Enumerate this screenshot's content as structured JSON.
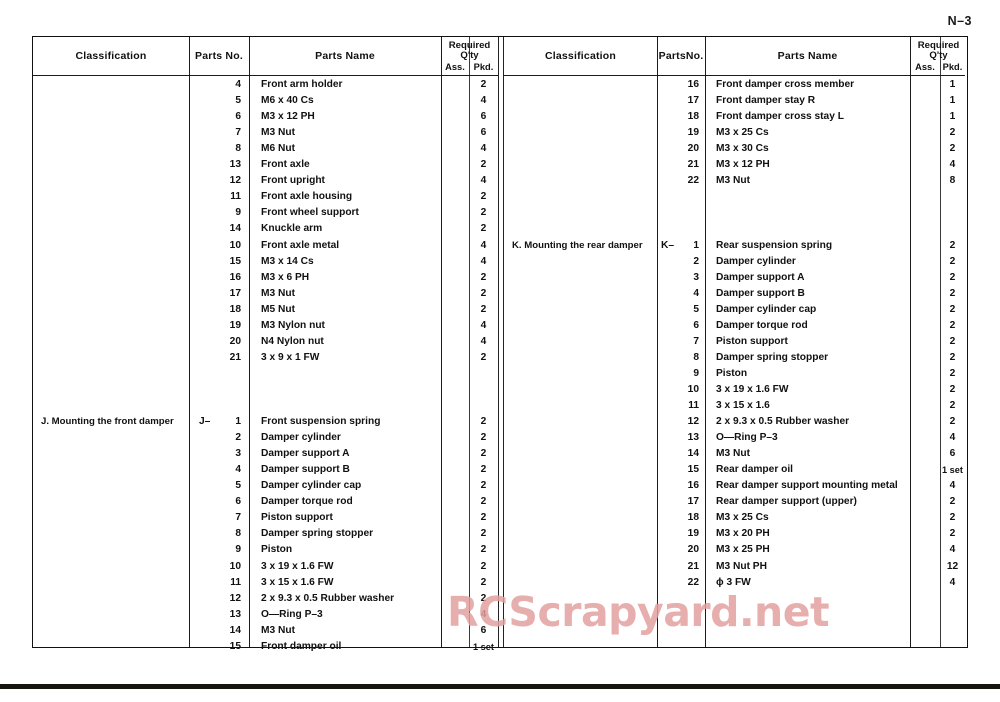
{
  "document": {
    "page_number": "N–3",
    "watermark": "RCScrapyard.net",
    "watermark_color": "#e3a0a0"
  },
  "header": {
    "classification": "Classification",
    "parts_no_left": "Parts No.",
    "parts_no_right": "PartsNo.",
    "parts_name": "Parts Name",
    "required": "Required",
    "qty": "Q'ty",
    "ass": "Ass.",
    "pkd": "Pkd."
  },
  "left_table": {
    "rows": [
      {
        "classification": "",
        "prefix": "",
        "no": "4",
        "name": "Front arm holder",
        "ass": "",
        "pkd": "2"
      },
      {
        "classification": "",
        "prefix": "",
        "no": "5",
        "name": "M6 x 40 Cs",
        "ass": "",
        "pkd": "4"
      },
      {
        "classification": "",
        "prefix": "",
        "no": "6",
        "name": "M3 x 12 PH",
        "ass": "",
        "pkd": "6"
      },
      {
        "classification": "",
        "prefix": "",
        "no": "7",
        "name": "M3 Nut",
        "ass": "",
        "pkd": "6"
      },
      {
        "classification": "",
        "prefix": "",
        "no": "8",
        "name": "M6 Nut",
        "ass": "",
        "pkd": "4"
      },
      {
        "classification": "",
        "prefix": "",
        "no": "13",
        "name": "Front axle",
        "ass": "",
        "pkd": "2"
      },
      {
        "classification": "",
        "prefix": "",
        "no": "12",
        "name": "Front upright",
        "ass": "",
        "pkd": "4"
      },
      {
        "classification": "",
        "prefix": "",
        "no": "11",
        "name": "Front axle housing",
        "ass": "",
        "pkd": "2"
      },
      {
        "classification": "",
        "prefix": "",
        "no": "9",
        "name": "Front wheel support",
        "ass": "",
        "pkd": "2"
      },
      {
        "classification": "",
        "prefix": "",
        "no": "14",
        "name": "Knuckle arm",
        "ass": "",
        "pkd": "2"
      },
      {
        "classification": "",
        "prefix": "",
        "no": "10",
        "name": "Front axle metal",
        "ass": "",
        "pkd": "4"
      },
      {
        "classification": "",
        "prefix": "",
        "no": "15",
        "name": "M3 x 14 Cs",
        "ass": "",
        "pkd": "4"
      },
      {
        "classification": "",
        "prefix": "",
        "no": "16",
        "name": "M3 x 6 PH",
        "ass": "",
        "pkd": "2"
      },
      {
        "classification": "",
        "prefix": "",
        "no": "17",
        "name": "M3 Nut",
        "ass": "",
        "pkd": "2"
      },
      {
        "classification": "",
        "prefix": "",
        "no": "18",
        "name": "M5 Nut",
        "ass": "",
        "pkd": "2"
      },
      {
        "classification": "",
        "prefix": "",
        "no": "19",
        "name": "M3 Nylon nut",
        "ass": "",
        "pkd": "4"
      },
      {
        "classification": "",
        "prefix": "",
        "no": "20",
        "name": "N4 Nylon nut",
        "ass": "",
        "pkd": "4"
      },
      {
        "classification": "",
        "prefix": "",
        "no": "21",
        "name": "3 x 9 x 1 FW",
        "ass": "",
        "pkd": "2"
      },
      {
        "classification": "",
        "prefix": "",
        "no": "",
        "name": "",
        "ass": "",
        "pkd": ""
      },
      {
        "classification": "",
        "prefix": "",
        "no": "",
        "name": "",
        "ass": "",
        "pkd": ""
      },
      {
        "classification": "",
        "prefix": "",
        "no": "",
        "name": "",
        "ass": "",
        "pkd": ""
      },
      {
        "classification": "J. Mounting the front damper",
        "prefix": "J–",
        "no": "1",
        "name": "Front suspension spring",
        "ass": "",
        "pkd": "2"
      },
      {
        "classification": "",
        "prefix": "",
        "no": "2",
        "name": "Damper cylinder",
        "ass": "",
        "pkd": "2"
      },
      {
        "classification": "",
        "prefix": "",
        "no": "3",
        "name": "Damper support A",
        "ass": "",
        "pkd": "2"
      },
      {
        "classification": "",
        "prefix": "",
        "no": "4",
        "name": "Damper support  B",
        "ass": "",
        "pkd": "2"
      },
      {
        "classification": "",
        "prefix": "",
        "no": "5",
        "name": "Damper cylinder cap",
        "ass": "",
        "pkd": "2"
      },
      {
        "classification": "",
        "prefix": "",
        "no": "6",
        "name": "Damper torque rod",
        "ass": "",
        "pkd": "2"
      },
      {
        "classification": "",
        "prefix": "",
        "no": "7",
        "name": "Piston support",
        "ass": "",
        "pkd": "2"
      },
      {
        "classification": "",
        "prefix": "",
        "no": "8",
        "name": "Damper spring stopper",
        "ass": "",
        "pkd": "2"
      },
      {
        "classification": "",
        "prefix": "",
        "no": "9",
        "name": "Piston",
        "ass": "",
        "pkd": "2"
      },
      {
        "classification": "",
        "prefix": "",
        "no": "10",
        "name": "3 x 19 x 1.6 FW",
        "ass": "",
        "pkd": "2"
      },
      {
        "classification": "",
        "prefix": "",
        "no": "11",
        "name": "3 x 15 x 1.6 FW",
        "ass": "",
        "pkd": "2"
      },
      {
        "classification": "",
        "prefix": "",
        "no": "12",
        "name": "2 x 9.3 x 0.5 Rubber washer",
        "ass": "",
        "pkd": "2"
      },
      {
        "classification": "",
        "prefix": "",
        "no": "13",
        "name": "O—Ring P–3",
        "ass": "",
        "pkd": "4"
      },
      {
        "classification": "",
        "prefix": "",
        "no": "14",
        "name": "M3 Nut",
        "ass": "",
        "pkd": "6"
      },
      {
        "classification": "",
        "prefix": "",
        "no": "15",
        "name": "Front damper oil",
        "ass": "",
        "pkd": "1 set"
      }
    ]
  },
  "right_table": {
    "rows": [
      {
        "classification": "",
        "prefix": "",
        "no": "16",
        "name": "Front damper cross member",
        "ass": "",
        "pkd": "1"
      },
      {
        "classification": "",
        "prefix": "",
        "no": "17",
        "name": "Front damper  stay R",
        "ass": "",
        "pkd": "1"
      },
      {
        "classification": "",
        "prefix": "",
        "no": "18",
        "name": "Front damper cross stay  L",
        "ass": "",
        "pkd": "1"
      },
      {
        "classification": "",
        "prefix": "",
        "no": "19",
        "name": "M3 x 25 Cs",
        "ass": "",
        "pkd": "2"
      },
      {
        "classification": "",
        "prefix": "",
        "no": "20",
        "name": "M3 x 30 Cs",
        "ass": "",
        "pkd": "2"
      },
      {
        "classification": "",
        "prefix": "",
        "no": "21",
        "name": "M3 x 12 PH",
        "ass": "",
        "pkd": "4"
      },
      {
        "classification": "",
        "prefix": "",
        "no": "22",
        "name": "M3 Nut",
        "ass": "",
        "pkd": "8"
      },
      {
        "classification": "",
        "prefix": "",
        "no": "",
        "name": "",
        "ass": "",
        "pkd": ""
      },
      {
        "classification": "",
        "prefix": "",
        "no": "",
        "name": "",
        "ass": "",
        "pkd": ""
      },
      {
        "classification": "",
        "prefix": "",
        "no": "",
        "name": "",
        "ass": "",
        "pkd": ""
      },
      {
        "classification": "K.  Mounting the rear damper",
        "prefix": "K–",
        "no": "1",
        "name": "Rear suspension spring",
        "ass": "",
        "pkd": "2"
      },
      {
        "classification": "",
        "prefix": "",
        "no": "2",
        "name": "Damper cylinder",
        "ass": "",
        "pkd": "2"
      },
      {
        "classification": "",
        "prefix": "",
        "no": "3",
        "name": "Damper support A",
        "ass": "",
        "pkd": "2"
      },
      {
        "classification": "",
        "prefix": "",
        "no": "4",
        "name": "Damper support B",
        "ass": "",
        "pkd": "2"
      },
      {
        "classification": "",
        "prefix": "",
        "no": "5",
        "name": "Damper cylinder cap",
        "ass": "",
        "pkd": "2"
      },
      {
        "classification": "",
        "prefix": "",
        "no": "6",
        "name": "Damper torque rod",
        "ass": "",
        "pkd": "2"
      },
      {
        "classification": "",
        "prefix": "",
        "no": "7",
        "name": "Piston support",
        "ass": "",
        "pkd": "2"
      },
      {
        "classification": "",
        "prefix": "",
        "no": "8",
        "name": "Damper spring stopper",
        "ass": "",
        "pkd": "2"
      },
      {
        "classification": "",
        "prefix": "",
        "no": "9",
        "name": "Piston",
        "ass": "",
        "pkd": "2"
      },
      {
        "classification": "",
        "prefix": "",
        "no": "10",
        "name": "3 x 19 x 1.6 FW",
        "ass": "",
        "pkd": "2"
      },
      {
        "classification": "",
        "prefix": "",
        "no": "11",
        "name": "3 x 15 x 1.6",
        "ass": "",
        "pkd": "2"
      },
      {
        "classification": "",
        "prefix": "",
        "no": "12",
        "name": "2 x 9.3 x 0.5 Rubber washer",
        "ass": "",
        "pkd": "2"
      },
      {
        "classification": "",
        "prefix": "",
        "no": "13",
        "name": "O—Ring P–3",
        "ass": "",
        "pkd": "4"
      },
      {
        "classification": "",
        "prefix": "",
        "no": "14",
        "name": "M3 Nut",
        "ass": "",
        "pkd": "6"
      },
      {
        "classification": "",
        "prefix": "",
        "no": "15",
        "name": "Rear damper oil",
        "ass": "",
        "pkd": "1 set"
      },
      {
        "classification": "",
        "prefix": "",
        "no": "16",
        "name": "Rear damper support mounting metal",
        "ass": "",
        "pkd": "4"
      },
      {
        "classification": "",
        "prefix": "",
        "no": "17",
        "name": "Rear damper support (upper)",
        "ass": "",
        "pkd": "2"
      },
      {
        "classification": "",
        "prefix": "",
        "no": "18",
        "name": "M3 x 25 Cs",
        "ass": "",
        "pkd": "2"
      },
      {
        "classification": "",
        "prefix": "",
        "no": "19",
        "name": "M3 x 20 PH",
        "ass": "",
        "pkd": "2"
      },
      {
        "classification": "",
        "prefix": "",
        "no": "20",
        "name": "M3 x 25 PH",
        "ass": "",
        "pkd": "4"
      },
      {
        "classification": "",
        "prefix": "",
        "no": "21",
        "name": "M3 Nut PH",
        "ass": "",
        "pkd": "12"
      },
      {
        "classification": "",
        "prefix": "",
        "no": "22",
        "name": "ϕ 3 FW",
        "ass": "",
        "pkd": "4"
      }
    ]
  }
}
